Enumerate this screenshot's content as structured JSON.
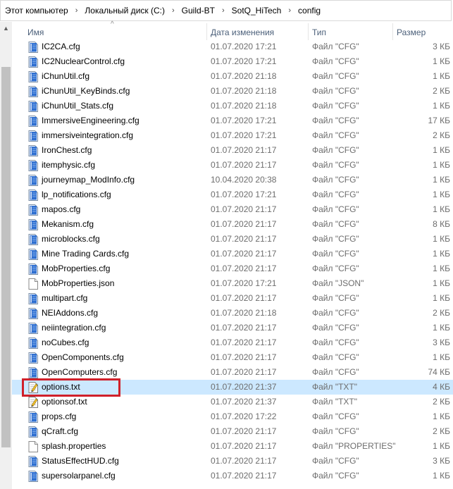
{
  "breadcrumb": [
    "Этот компьютер",
    "Локальный диск (C:)",
    "Guild-BT",
    "SotQ_HiTech",
    "config"
  ],
  "columns": {
    "name": "Имя",
    "date": "Дата изменения",
    "type": "Тип",
    "size": "Размер"
  },
  "files": [
    {
      "name": "IC2CA.cfg",
      "date": "01.07.2020 17:21",
      "type": "Файл \"CFG\"",
      "size": "3 КБ",
      "icon": "cfg"
    },
    {
      "name": "IC2NuclearControl.cfg",
      "date": "01.07.2020 17:21",
      "type": "Файл \"CFG\"",
      "size": "1 КБ",
      "icon": "cfg"
    },
    {
      "name": "iChunUtil.cfg",
      "date": "01.07.2020 21:18",
      "type": "Файл \"CFG\"",
      "size": "1 КБ",
      "icon": "cfg"
    },
    {
      "name": "iChunUtil_KeyBinds.cfg",
      "date": "01.07.2020 21:18",
      "type": "Файл \"CFG\"",
      "size": "2 КБ",
      "icon": "cfg"
    },
    {
      "name": "iChunUtil_Stats.cfg",
      "date": "01.07.2020 21:18",
      "type": "Файл \"CFG\"",
      "size": "1 КБ",
      "icon": "cfg"
    },
    {
      "name": "ImmersiveEngineering.cfg",
      "date": "01.07.2020 17:21",
      "type": "Файл \"CFG\"",
      "size": "17 КБ",
      "icon": "cfg"
    },
    {
      "name": "immersiveintegration.cfg",
      "date": "01.07.2020 17:21",
      "type": "Файл \"CFG\"",
      "size": "2 КБ",
      "icon": "cfg"
    },
    {
      "name": "IronChest.cfg",
      "date": "01.07.2020 21:17",
      "type": "Файл \"CFG\"",
      "size": "1 КБ",
      "icon": "cfg"
    },
    {
      "name": "itemphysic.cfg",
      "date": "01.07.2020 21:17",
      "type": "Файл \"CFG\"",
      "size": "1 КБ",
      "icon": "cfg"
    },
    {
      "name": "journeymap_ModInfo.cfg",
      "date": "10.04.2020 20:38",
      "type": "Файл \"CFG\"",
      "size": "1 КБ",
      "icon": "cfg"
    },
    {
      "name": "lp_notifications.cfg",
      "date": "01.07.2020 17:21",
      "type": "Файл \"CFG\"",
      "size": "1 КБ",
      "icon": "cfg"
    },
    {
      "name": "mapos.cfg",
      "date": "01.07.2020 21:17",
      "type": "Файл \"CFG\"",
      "size": "1 КБ",
      "icon": "cfg"
    },
    {
      "name": "Mekanism.cfg",
      "date": "01.07.2020 21:17",
      "type": "Файл \"CFG\"",
      "size": "8 КБ",
      "icon": "cfg"
    },
    {
      "name": "microblocks.cfg",
      "date": "01.07.2020 21:17",
      "type": "Файл \"CFG\"",
      "size": "1 КБ",
      "icon": "cfg"
    },
    {
      "name": "Mine Trading Cards.cfg",
      "date": "01.07.2020 21:17",
      "type": "Файл \"CFG\"",
      "size": "1 КБ",
      "icon": "cfg"
    },
    {
      "name": "MobProperties.cfg",
      "date": "01.07.2020 21:17",
      "type": "Файл \"CFG\"",
      "size": "1 КБ",
      "icon": "cfg"
    },
    {
      "name": "MobProperties.json",
      "date": "01.07.2020 17:21",
      "type": "Файл \"JSON\"",
      "size": "1 КБ",
      "icon": "blank"
    },
    {
      "name": "multipart.cfg",
      "date": "01.07.2020 21:17",
      "type": "Файл \"CFG\"",
      "size": "1 КБ",
      "icon": "cfg"
    },
    {
      "name": "NEIAddons.cfg",
      "date": "01.07.2020 21:18",
      "type": "Файл \"CFG\"",
      "size": "2 КБ",
      "icon": "cfg"
    },
    {
      "name": "neiintegration.cfg",
      "date": "01.07.2020 21:17",
      "type": "Файл \"CFG\"",
      "size": "1 КБ",
      "icon": "cfg"
    },
    {
      "name": "noCubes.cfg",
      "date": "01.07.2020 21:17",
      "type": "Файл \"CFG\"",
      "size": "3 КБ",
      "icon": "cfg"
    },
    {
      "name": "OpenComponents.cfg",
      "date": "01.07.2020 21:17",
      "type": "Файл \"CFG\"",
      "size": "1 КБ",
      "icon": "cfg"
    },
    {
      "name": "OpenComputers.cfg",
      "date": "01.07.2020 21:17",
      "type": "Файл \"CFG\"",
      "size": "74 КБ",
      "icon": "cfg"
    },
    {
      "name": "options.txt",
      "date": "01.07.2020 21:37",
      "type": "Файл \"TXT\"",
      "size": "4 КБ",
      "icon": "txt",
      "selected": true
    },
    {
      "name": "optionsof.txt",
      "date": "01.07.2020 21:37",
      "type": "Файл \"TXT\"",
      "size": "2 КБ",
      "icon": "txt"
    },
    {
      "name": "props.cfg",
      "date": "01.07.2020 17:22",
      "type": "Файл \"CFG\"",
      "size": "1 КБ",
      "icon": "cfg"
    },
    {
      "name": "qCraft.cfg",
      "date": "01.07.2020 21:17",
      "type": "Файл \"CFG\"",
      "size": "2 КБ",
      "icon": "cfg"
    },
    {
      "name": "splash.properties",
      "date": "01.07.2020 21:17",
      "type": "Файл \"PROPERTIES\"",
      "size": "1 КБ",
      "icon": "blank"
    },
    {
      "name": "StatusEffectHUD.cfg",
      "date": "01.07.2020 21:17",
      "type": "Файл \"CFG\"",
      "size": "3 КБ",
      "icon": "cfg"
    },
    {
      "name": "supersolarpanel.cfg",
      "date": "01.07.2020 21:17",
      "type": "Файл \"CFG\"",
      "size": "1 КБ",
      "icon": "cfg"
    }
  ],
  "colors": {
    "selected_row": "#cce8ff",
    "highlight_border": "#d0202a",
    "header_text": "#4c607a"
  }
}
